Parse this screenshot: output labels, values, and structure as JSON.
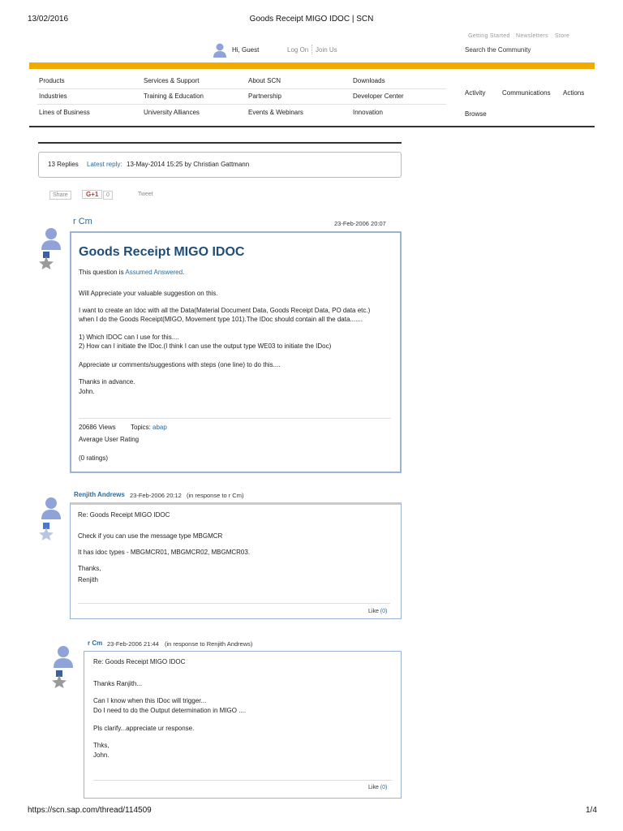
{
  "print_header": {
    "date": "13/02/2016",
    "title": "Goods Receipt MIGO IDOC | SCN"
  },
  "print_footer": {
    "url": "https://scn.sap.com/thread/114509",
    "page": "1/4"
  },
  "top_links": [
    "Getting Started",
    "Newsletters",
    "Store"
  ],
  "user": {
    "greeting": "Hi, Guest",
    "log_on": "Log On",
    "join_us": "Join Us"
  },
  "search": {
    "placeholder": "Search the Community"
  },
  "nav": {
    "col1": [
      "Products",
      "Industries",
      "Lines of Business"
    ],
    "col2": [
      "Services & Support",
      "Training & Education",
      "University Alliances"
    ],
    "col3": [
      "About SCN",
      "Partnership",
      "Events & Webinars"
    ],
    "col4": [
      "Downloads",
      "Developer Center",
      "Innovation"
    ],
    "right": [
      "Activity",
      "Communications",
      "Actions",
      "Browse"
    ]
  },
  "thread_info": {
    "replies": "13 Replies",
    "latest_label": "Latest reply:",
    "latest_text": "13-May-2014 15:25 by Christian Gattmann"
  },
  "social": {
    "share": "Share",
    "gplus": "G+1",
    "gplus_count": "0",
    "tweet": "Tweet"
  },
  "original_post": {
    "author": "r Cm",
    "date": "23-Feb-2006 20:07",
    "title": "Goods Receipt MIGO IDOC",
    "status_prefix": "This question is",
    "status": "Assumed Answered",
    "status_suffix": ".",
    "body": [
      "Will Appreciate your valuable suggestion on this.",
      "I want to create an Idoc with all the Data(Material Document Data, Goods Receipt Data, PO data etc.)",
      "when I do the Goods Receipt(MIGO, Movement type 101).The IDoc should contain all the data.......",
      "1) Which IDOC can I use for this....",
      "2) How can I initiate the IDoc.(I think I can use the output type WE03 to initiate the IDoc)",
      "Appreciate ur comments/suggestions with steps (one line) to do this....",
      "Thanks in advance.",
      "John."
    ],
    "views": "20686 Views",
    "topics_label": "Topics:",
    "topic": "abap",
    "rating_label": "Average User Rating",
    "ratings": "(0 ratings)"
  },
  "reply1": {
    "author": "Renjith Andrews",
    "date": "23-Feb-2006 20:12",
    "in_response": "(in response to r Cm)",
    "title": "Re: Goods Receipt MIGO IDOC",
    "body": [
      "Check if you can use the message type MBGMCR",
      "It has idoc types - MBGMCR01, MBGMCR02, MBGMCR03.",
      "Thanks,",
      "Renjith"
    ],
    "like": "Like",
    "like_count": "(0)"
  },
  "reply2": {
    "author": "r Cm",
    "date": "23-Feb-2006 21:44",
    "in_response": "(in response to Renjith Andrews)",
    "title": "Re: Goods Receipt MIGO IDOC",
    "body": [
      "Thanks Ranjith...",
      "Can I know when this IDoc will trigger...",
      "Do I need to do the Output determination in MIGO ....",
      "Pls clarify...appreciate ur response.",
      "Thks,",
      "John."
    ],
    "like": "Like",
    "like_count": "(0)"
  },
  "colors": {
    "accent": "#f0ab00",
    "link": "#2a6b9b",
    "title": "#1f4d7a",
    "post_border": "#9cb4d3"
  }
}
